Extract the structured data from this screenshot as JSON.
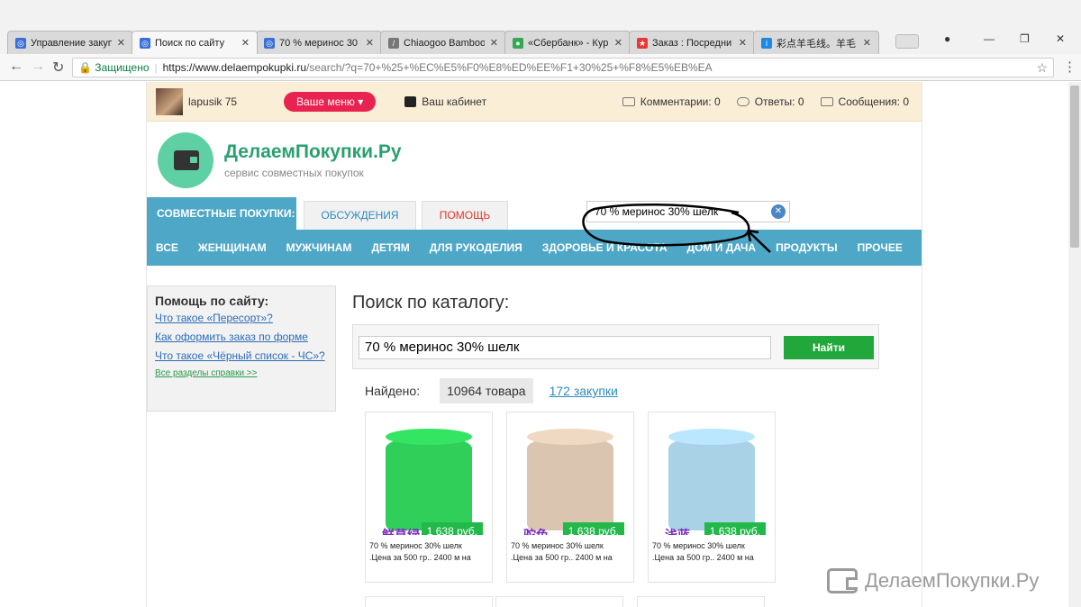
{
  "browser": {
    "tabs": [
      {
        "title": "Управление закуп",
        "color": "#3a6fd8",
        "glyph": "◎"
      },
      {
        "title": "Поиск по сайту",
        "color": "#3a6fd8",
        "glyph": "◎",
        "active": true
      },
      {
        "title": "70 % меринос 30",
        "color": "#3a6fd8",
        "glyph": "◎"
      },
      {
        "title": "Chiaogoo Bamboo",
        "color": "#777777",
        "glyph": "/"
      },
      {
        "title": "«Сбербанк» - Кур",
        "color": "#34a853",
        "glyph": "●"
      },
      {
        "title": "Заказ : Посредни",
        "color": "#e53935",
        "glyph": "★"
      },
      {
        "title": "彩点羊毛线。羊毛",
        "color": "#1e88e5",
        "glyph": "i"
      }
    ],
    "close_glyph": "✕",
    "secure_label": "Защищено",
    "url_host": "https://www.delaempokupki.ru",
    "url_path": "/search/?q=70+%25+%EC%E5%F0%E8%ED%EE%F1+30%25+%F8%E5%EB%EA",
    "icons": {
      "back": "arrow-left-icon",
      "forward": "arrow-right-icon",
      "reload": "reload-icon",
      "bookmark": "star-icon",
      "menu": "kebab-menu-icon"
    }
  },
  "userbar": {
    "username": "lapusik 75",
    "menu_button": "Ваше меню ▾",
    "cabinet": "Ваш кабинет",
    "comments": "Комментарии: 0",
    "answers": "Ответы: 0",
    "messages": "Сообщения: 0"
  },
  "logo": {
    "title": "ДелаемПокупки.Ру",
    "subtitle": "сервис совместных покупок"
  },
  "topnav": {
    "section_label": "СОВМЕСТНЫЕ ПОКУПКИ:",
    "tab_discussions": "ОБСУЖДЕНИЯ",
    "tab_help": "ПОМОЩЬ",
    "search_value": "70 % меринос 30% шелк"
  },
  "categories": [
    "ВСЕ",
    "ЖЕНЩИНАМ",
    "МУЖЧИНАМ",
    "ДЕТЯМ",
    "ДЛЯ РУКОДЕЛИЯ",
    "ЗДОРОВЬЕ И КРАСОТА",
    "ДОМ И ДАЧА",
    "ПРОДУКТЫ",
    "ПРОЧЕЕ"
  ],
  "sidebar": {
    "title": "Помощь по сайту:",
    "links": [
      "Что такое «Пересорт»?",
      "Как оформить заказ по форме",
      "Что такое «Чёрный список - ЧС»?"
    ],
    "all_link": "Все разделы справки >>"
  },
  "main": {
    "title": "Поиск по каталогу:",
    "search_value": "70 % меринос 30% шелк",
    "search_button": "Найти",
    "found_label": "Найдено:",
    "found_goods": "10964 товара",
    "found_purchases": "172 закупки"
  },
  "products": [
    {
      "price": "1 638 руб.",
      "cn": "鲜草绿",
      "cn_color": "#7b2cbf",
      "yarn_color": "#2fcf5a",
      "line1": "70 % меринос 30% шелк",
      "line2": ".Цена за 500 гр.. 2400 м на"
    },
    {
      "price": "1 638 руб.",
      "cn": "驼色",
      "cn_color": "#7b2cbf",
      "yarn_color": "#d9c5b0",
      "line1": "70 % меринос 30% шелк",
      "line2": ".Цена за 500 гр.. 2400 м на"
    },
    {
      "price": "1 638 руб.",
      "cn": "浅蓝",
      "cn_color": "#7b2cbf",
      "yarn_color": "#a9d2e6",
      "line1": "70 % меринос 30% шелк",
      "line2": ".Цена за 500 гр.. 2400 м на"
    }
  ],
  "watermark": "ДелаемПокупки.Ру"
}
